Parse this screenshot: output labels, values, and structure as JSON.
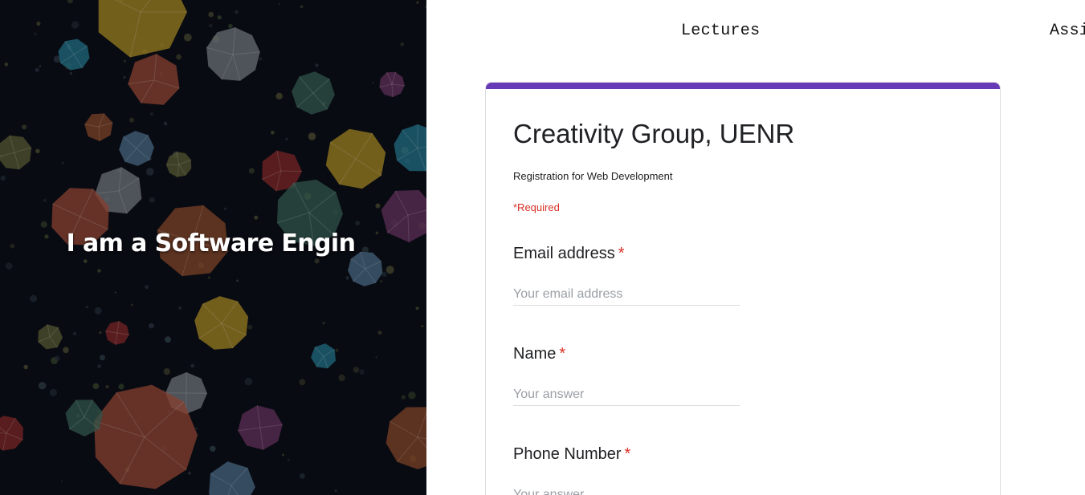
{
  "hero": {
    "title": "I am a Software Engin"
  },
  "nav": {
    "items": [
      {
        "label": "Lectures"
      },
      {
        "label": "Assi"
      }
    ]
  },
  "form": {
    "accent_color": "#673ab7",
    "title": "Creativity Group, UENR",
    "description": "Registration for Web Development",
    "required_note": "*Required",
    "questions": [
      {
        "label": "Email address",
        "required_mark": "*",
        "placeholder": "Your email address"
      },
      {
        "label": "Name",
        "required_mark": "*",
        "placeholder": "Your answer"
      },
      {
        "label": "Phone Number",
        "required_mark": "*",
        "placeholder": "Your answer"
      }
    ]
  },
  "colors": {
    "required": "#d93025",
    "hero_background": "#0b0d14"
  }
}
